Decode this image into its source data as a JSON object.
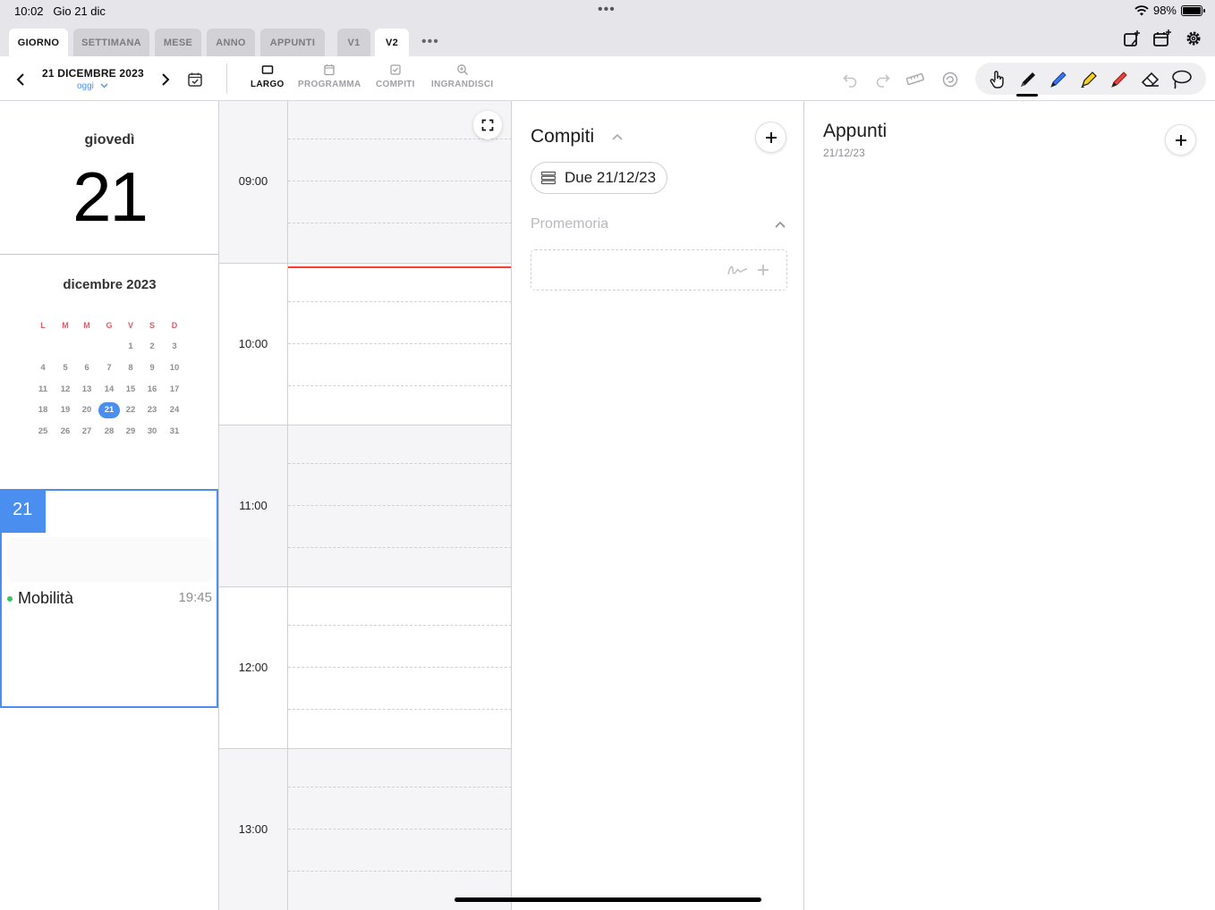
{
  "status_bar": {
    "time": "10:02",
    "date": "Gio 21 dic",
    "battery": "98%",
    "battery_level": 0.98
  },
  "tabs": [
    {
      "label": "GIORNO",
      "active": true
    },
    {
      "label": "SETTIMANA",
      "active": false
    },
    {
      "label": "MESE",
      "active": false
    },
    {
      "label": "ANNO",
      "active": false
    },
    {
      "label": "APPUNTI",
      "active": false
    },
    {
      "label": "V1",
      "active": false
    },
    {
      "label": "V2",
      "active": true
    }
  ],
  "top_icons": [
    "new-note-icon",
    "new-calendar-icon",
    "settings-gear-icon"
  ],
  "toolbar": {
    "date_title": "21 DICEMBRE 2023",
    "today_label": "oggi",
    "modes": [
      {
        "label": "LARGO",
        "icon": "layout-wide-icon",
        "active": true
      },
      {
        "label": "PROGRAMMA",
        "icon": "calendar-icon",
        "active": false
      },
      {
        "label": "COMPITI",
        "icon": "checkbox-icon",
        "active": false
      },
      {
        "label": "INGRANDISCI",
        "icon": "zoom-icon",
        "active": false
      }
    ],
    "edit_icons": [
      "undo-icon",
      "redo-icon",
      "ruler-icon",
      "shape-recognition-icon"
    ],
    "pen_tools": [
      {
        "name": "hand-pointer-icon",
        "color": "#1c1c1e"
      },
      {
        "name": "pen-black-icon",
        "color": "#111111",
        "selected": true
      },
      {
        "name": "pen-blue-icon",
        "color": "#3478f6"
      },
      {
        "name": "highlighter-yellow-icon",
        "color": "#f6d21f"
      },
      {
        "name": "pen-red-icon",
        "color": "#e8443a"
      },
      {
        "name": "eraser-icon",
        "color": "#1c1c1e"
      },
      {
        "name": "lasso-icon",
        "color": "#1c1c1e"
      }
    ]
  },
  "day_panel": {
    "weekday": "giovedì",
    "day_number": "21"
  },
  "mini_calendar": {
    "title": "dicembre 2023",
    "weekday_headers": [
      "L",
      "M",
      "M",
      "G",
      "V",
      "S",
      "D"
    ],
    "weeks": [
      [
        "",
        "",
        "",
        "",
        "1",
        "2",
        "3"
      ],
      [
        "4",
        "5",
        "6",
        "7",
        "8",
        "9",
        "10"
      ],
      [
        "11",
        "12",
        "13",
        "14",
        "15",
        "16",
        "17"
      ],
      [
        "18",
        "19",
        "20",
        "21",
        "22",
        "23",
        "24"
      ],
      [
        "25",
        "26",
        "27",
        "28",
        "29",
        "30",
        "31"
      ]
    ],
    "selected_day": "21"
  },
  "day_card": {
    "badge": "21",
    "event": {
      "title": "Mobilità",
      "time": "19:45",
      "dot_color": "#34c759"
    }
  },
  "timeline": {
    "hours": [
      "09:00",
      "10:00",
      "11:00",
      "12:00",
      "13:00"
    ],
    "now_time": "10:02"
  },
  "tasks": {
    "title": "Compiti",
    "due_chip": "Due 21/12/23",
    "reminder_title": "Promemoria"
  },
  "notes": {
    "title": "Appunti",
    "date": "21/12/23"
  },
  "colors": {
    "accent": "#4a8ef0",
    "weekend_red": "#e05a6a",
    "now_line": "#ff3b30"
  }
}
